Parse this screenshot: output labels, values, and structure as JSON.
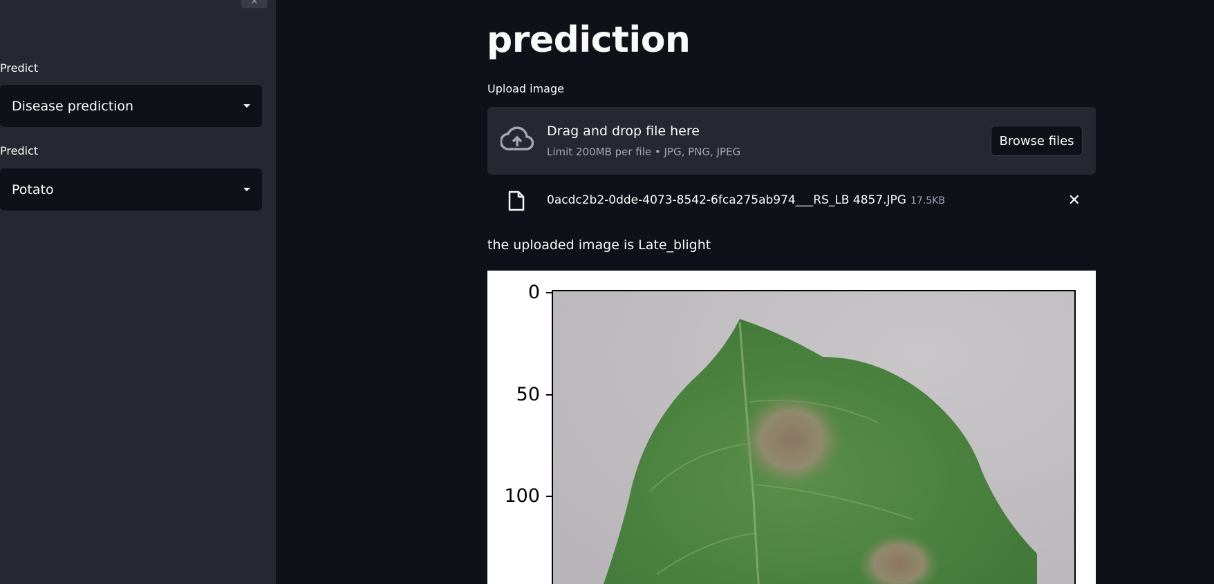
{
  "sidebar": {
    "collapse_icon": "close-icon",
    "selects": [
      {
        "label": "Predict",
        "value": "Disease prediction"
      },
      {
        "label": "Predict",
        "value": "Potato"
      }
    ]
  },
  "main": {
    "title": "prediction",
    "uploader": {
      "label": "Upload image",
      "drop_title": "Drag and drop file here",
      "drop_subtitle": "Limit 200MB per file • JPG, PNG, JPEG",
      "browse_label": "Browse files"
    },
    "file": {
      "name": "0acdc2b2-0dde-4073-8542-6fca275ab974___RS_LB 4857.JPG",
      "size": "17.5KB"
    },
    "result": "the uploaded image is Late_blight",
    "figure": {
      "y_ticks": [
        "0",
        "50",
        "100"
      ]
    }
  },
  "colors": {
    "background": "#0e1117",
    "sidebar": "#262730",
    "dropzone": "#262730",
    "text": "#fafafa",
    "muted": "#a3a8b8"
  }
}
